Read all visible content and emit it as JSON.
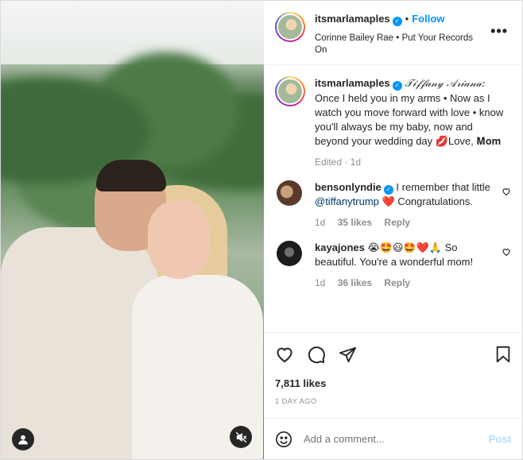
{
  "post": {
    "author": "itsmarlamaples",
    "follow_label": "Follow",
    "dot": "•",
    "audio": "Corinne Bailey Rae • Put Your Records On",
    "more_icon": "more-horizontal-icon",
    "caption": {
      "username": "itsmarlamaples",
      "script_name": "𝒯𝒾𝒻𝒻𝒶𝓃𝓎 𝒜𝓇𝒾𝒶𝓃𝒶:",
      "text": " Once I held you in my arms • Now as I watch you move forward with love • know you'll always be my baby, now and beyond your wedding day ",
      "love": "💋Love, ",
      "mom": "𝐌𝐨𝐦",
      "meta": "Edited · 1d"
    },
    "comments": [
      {
        "username": "bensonlyndie",
        "text_before": " I remember that little ",
        "mention": "@tiffanytrump",
        "text_after": " ❤️ Congratulations.",
        "time": "1d",
        "likes": "35 likes",
        "reply": "Reply"
      },
      {
        "username": "kayajones",
        "text": " 😭🤩😃🤩❤️🙏 So beautiful. You're a wonderful mom!",
        "time": "1d",
        "likes": "36 likes",
        "reply": "Reply"
      }
    ],
    "likes": "7,811 likes",
    "date": "1 DAY AGO",
    "add_comment_placeholder": "Add a comment...",
    "post_label": "Post"
  },
  "colors": {
    "accent": "#0095f6",
    "muted": "#8e8e8e",
    "post_disabled": "#b2dffc",
    "like_heart": "#ed4956"
  }
}
